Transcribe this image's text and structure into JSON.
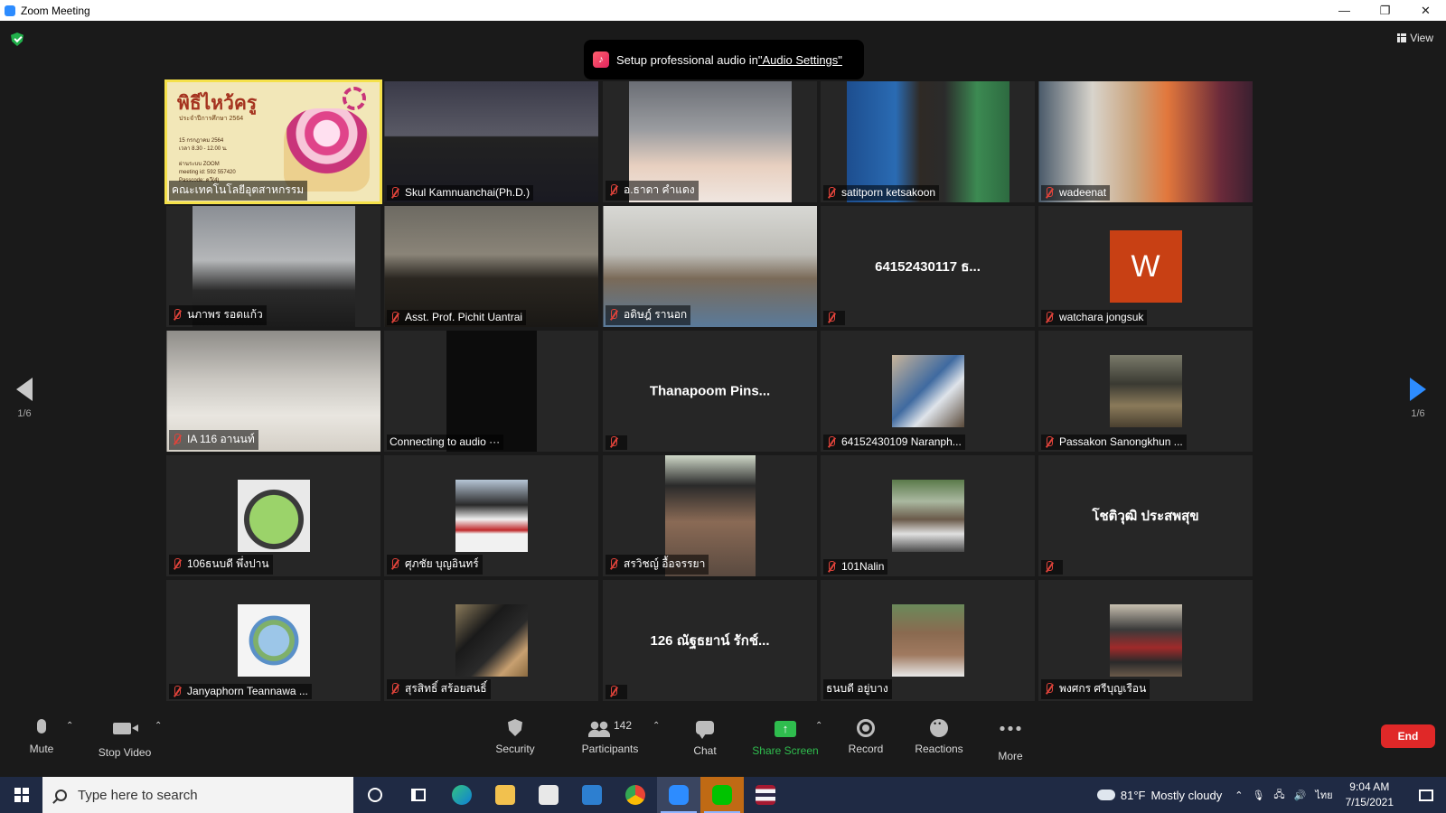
{
  "window": {
    "title": "Zoom Meeting",
    "controls": [
      "—",
      "❐",
      "✕"
    ]
  },
  "top": {
    "view_label": "View",
    "banner_text": "Setup professional audio in ",
    "banner_link": "\"Audio Settings\""
  },
  "paging": {
    "left": "1/6",
    "right": "1/6"
  },
  "tiles": [
    {
      "name": "คณะเทคโนโลยีอุตสาหกรรม",
      "muted": false
    },
    {
      "name": "Skul Kamnuanchai(Ph.D.)",
      "muted": true
    },
    {
      "name": "อ.ธาดา คำแดง",
      "muted": true
    },
    {
      "name": "satitporn ketsakoon",
      "muted": true
    },
    {
      "name": "wadeenat",
      "muted": true
    },
    {
      "name": "นภาพร รอดแก้ว",
      "muted": true
    },
    {
      "name": "Asst. Prof. Pichit Uantrai",
      "muted": true
    },
    {
      "name": "อดิษฎ์ รานอก",
      "muted": true
    },
    {
      "name": "",
      "display": "64152430117  ธ...",
      "muted": true
    },
    {
      "name": "watchara jongsuk",
      "initial": "W",
      "muted": true
    },
    {
      "name": "IA 116 อานนท์",
      "muted": true
    },
    {
      "name": "Connecting to audio ···",
      "muted": false
    },
    {
      "name": "",
      "display": "Thanapoom  Pins...",
      "muted": true
    },
    {
      "name": "64152430109 Naranph...",
      "muted": true
    },
    {
      "name": "Passakon Sanongkhun ...",
      "muted": true
    },
    {
      "name": "106ธนบดี พึ่งปาน",
      "muted": true
    },
    {
      "name": "ศุภชัย บุญอินทร์",
      "muted": true
    },
    {
      "name": "สรวิชญ์ อื้อจรรยา",
      "muted": true
    },
    {
      "name": "101Nalin",
      "muted": true
    },
    {
      "name": "",
      "display": "โชติวุฒิ ประสพสุข",
      "muted": true
    },
    {
      "name": "Janyaphorn Teannawa ...",
      "muted": true
    },
    {
      "name": "สุรสิทธิ์ สร้อยสนธิ์",
      "muted": true
    },
    {
      "name": "",
      "display": "126 ณัฐธยาน์ รักช์...",
      "muted": true
    },
    {
      "name": "ธนบดี อยู่บาง",
      "muted": false
    },
    {
      "name": "พงศกร ศรีบุญเรือน",
      "muted": true
    }
  ],
  "slide": {
    "title": "พิธีไหว้ครู",
    "subtitle": "ประจำปีการศึกษา 2564",
    "info1": "15 กรกฎาคม 2564",
    "info2": "เวลา 8.30 - 12.00 น.",
    "info3": "ผ่านระบบ ZOOM",
    "info4": "meeting id: 592 557420",
    "info5": "Passcode: ควี(4)"
  },
  "toolbar": {
    "mute": "Mute",
    "stop_video": "Stop Video",
    "security": "Security",
    "participants": "Participants",
    "participants_count": "142",
    "chat": "Chat",
    "share_screen": "Share Screen",
    "record": "Record",
    "reactions": "Reactions",
    "more": "More",
    "end": "End"
  },
  "taskbar": {
    "search_placeholder": "Type here to search",
    "weather_temp": "81°F",
    "weather_desc": "Mostly cloudy",
    "lang": "ไทย",
    "time": "9:04 AM",
    "date": "7/15/2021"
  },
  "colors": {
    "active_speaker": "#f5e14a",
    "end_button": "#e02828",
    "share_green": "#2fbd4e",
    "mute_red": "#e0433a",
    "nav_blue": "#2d8cff"
  }
}
